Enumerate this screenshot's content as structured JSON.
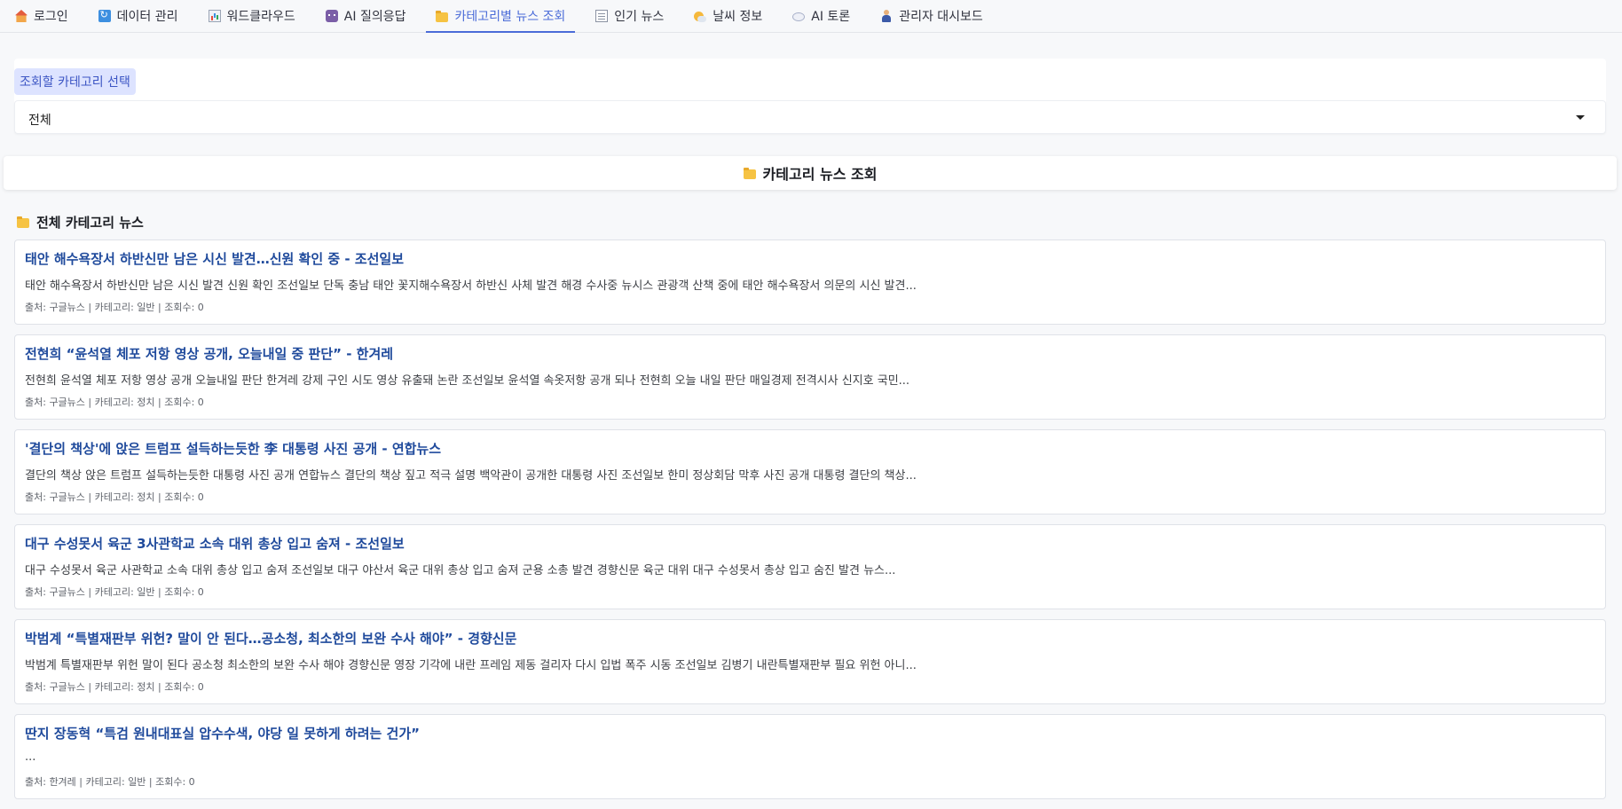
{
  "tabs": [
    {
      "label": "로그인",
      "icon": "house-icon"
    },
    {
      "label": "데이터 관리",
      "icon": "refresh-icon"
    },
    {
      "label": "워드클라우드",
      "icon": "bar-chart-icon"
    },
    {
      "label": "AI 질의응답",
      "icon": "robot-icon"
    },
    {
      "label": "카테고리별 뉴스 조회",
      "icon": "folder-icon",
      "active": true
    },
    {
      "label": "인기 뉴스",
      "icon": "newspaper-icon"
    },
    {
      "label": "날씨 정보",
      "icon": "weather-icon"
    },
    {
      "label": "AI 토론",
      "icon": "speech-bubble-icon"
    },
    {
      "label": "관리자 대시보드",
      "icon": "admin-person-icon"
    }
  ],
  "category_select": {
    "label": "조회할 카테고리 선택",
    "value": "전체"
  },
  "header": {
    "title": "카테고리 뉴스 조회",
    "icon": "folder-icon"
  },
  "section": {
    "title": "전체 카테고리 뉴스",
    "icon": "folder-icon"
  },
  "news": [
    {
      "title": "태안 해수욕장서 하반신만 남은 시신 발견…신원 확인 중 - 조선일보",
      "summary": "태안 해수욕장서 하반신만 남은 시신 발견 신원 확인 조선일보 단독 충남 태안 꽃지해수욕장서 하반신 사체 발견 해경 수사중 뉴시스 관광객 산책 중에 태안 해수욕장서 의문의 시신 발견...",
      "meta": "출처: 구글뉴스 | 카테고리: 일반 | 조회수: 0"
    },
    {
      "title": "전현희 “윤석열 체포 저항 영상 공개, 오늘내일 중 판단” - 한겨레",
      "summary": "전현희 윤석열 체포 저항 영상 공개 오늘내일 판단 한겨레 강제 구인 시도 영상 유출돼 논란 조선일보 윤석열 속옷저항 공개 되나 전현희 오늘 내일 판단 매일경제 전격시사 신지호 국민...",
      "meta": "출처: 구글뉴스 | 카테고리: 정치 | 조회수: 0"
    },
    {
      "title": "'결단의 책상'에 앉은 트럼프 설득하는듯한 李 대통령 사진 공개 - 연합뉴스",
      "summary": "결단의 책상 앉은 트럼프 설득하는듯한 대통령 사진 공개 연합뉴스 결단의 책상 짚고 적극 설명 백악관이 공개한 대통령 사진 조선일보 한미 정상회담 막후 사진 공개 대통령 결단의 책상...",
      "meta": "출처: 구글뉴스 | 카테고리: 정치 | 조회수: 0"
    },
    {
      "title": "대구 수성못서 육군 3사관학교 소속 대위 총상 입고 숨져 - 조선일보",
      "summary": "대구 수성못서 육군 사관학교 소속 대위 총상 입고 숨져 조선일보 대구 야산서 육군 대위 총상 입고 숨져 군용 소총 발견 경향신문 육군 대위 대구 수성못서 총상 입고 숨진 발견 뉴스...",
      "meta": "출처: 구글뉴스 | 카테고리: 일반 | 조회수: 0"
    },
    {
      "title": "박범계 “특별재판부 위헌? 말이 안 된다…공소청, 최소한의 보완 수사 해야” - 경향신문",
      "summary": "박범계 특별재판부 위헌 말이 된다 공소청 최소한의 보완 수사 해야 경향신문 영장 기각에 내란 프레임 제동 걸리자 다시 입법 폭주 시동 조선일보 김병기 내란특별재판부 필요 위헌 아니...",
      "meta": "출처: 구글뉴스 | 카테고리: 정치 | 조회수: 0"
    },
    {
      "title": "딴지 장동혁 “특검 원내대표실 압수수색, 야당 일 못하게 하려는 건가”",
      "summary": "...",
      "meta": "출처: 한겨레 | 카테고리: 일반 | 조회수: 0"
    }
  ]
}
